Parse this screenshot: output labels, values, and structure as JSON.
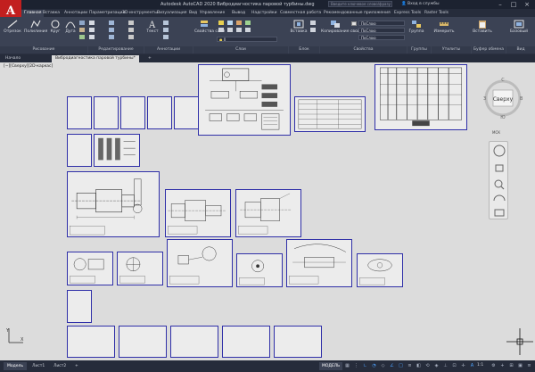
{
  "window": {
    "app_logo": "A",
    "title": "Autodesk AutoCAD 2020   Вибродиагностика паровой турбины.dwg",
    "search_placeholder": "Введите ключевое слово/фразу",
    "login": "Вход в службы",
    "controls": [
      "–",
      "□",
      "×"
    ]
  },
  "ribbon": {
    "tabs": [
      "Главная",
      "Вставка",
      "Аннотации",
      "Параметризация",
      "3D-инструменты",
      "Визуализация",
      "Вид",
      "Управление",
      "Вывод",
      "Надстройки",
      "Совместная работа",
      "Рекомендованные приложения",
      "Express Tools",
      "Raster Tools"
    ],
    "active_tab": 0,
    "draw_buttons": [
      "Отрезок",
      "Полилиния",
      "Круг",
      "Дуга"
    ],
    "text_button": "Текст",
    "layer_props_button": "Свойства слоя",
    "insert_button": "Вставка",
    "copy_props_button": "Копирование свойств",
    "group_button": "Группа",
    "measure_button": "Измерить",
    "paste_button": "Вставить",
    "base_button": "Базовый",
    "layer_field": "0",
    "prop_fields": [
      "ПоСлою",
      "ПоСлою",
      "ПоСлою"
    ],
    "panels": [
      "Рисование",
      "Редактирование",
      "Аннотации",
      "Слои",
      "Блок",
      "Свойства",
      "Группы",
      "Утилиты",
      "Буфер обмена",
      "Вид"
    ]
  },
  "doc_tabs": [
    "Начало",
    "Вибродиагностика паровой турбины*",
    "+"
  ],
  "viewport": {
    "view_label": "[−][Сверху][2D-каркас]",
    "viewcube": {
      "face": "Сверху",
      "north": "С",
      "south": "Ю",
      "west": "З",
      "east": "В",
      "ucs": "МСК"
    }
  },
  "layout_tabs": [
    "Модель",
    "Лист1",
    "Лист2",
    "+"
  ],
  "statusbar": {
    "model": "МОДЕЛЬ",
    "scale": "1:1"
  },
  "colors": {
    "ribbon_bg": "#3b4254",
    "titlebar_bg": "#1c2230",
    "canvas_bg": "#dcdcdc",
    "sheet_border": "#2f2fa8",
    "logo_red": "#c21f1f"
  }
}
